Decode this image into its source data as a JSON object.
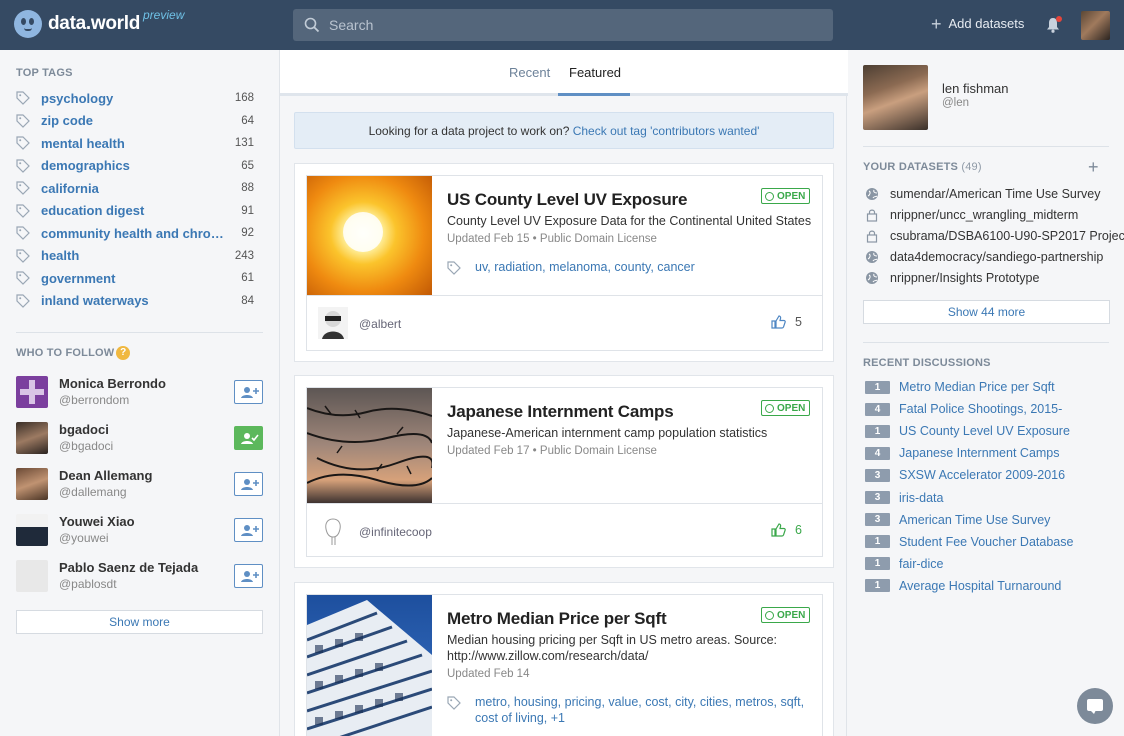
{
  "header": {
    "logo_text": "data.world",
    "logo_badge": "preview",
    "search_placeholder": "Search",
    "add_datasets_label": "Add datasets"
  },
  "top_tags": {
    "title": "TOP TAGS",
    "items": [
      {
        "name": "psychology",
        "count": "168"
      },
      {
        "name": "zip code",
        "count": "64"
      },
      {
        "name": "mental health",
        "count": "131"
      },
      {
        "name": "demographics",
        "count": "65"
      },
      {
        "name": "california",
        "count": "88"
      },
      {
        "name": "education digest",
        "count": "91"
      },
      {
        "name": "community health and chronic di...",
        "count": "92"
      },
      {
        "name": "health",
        "count": "243"
      },
      {
        "name": "government",
        "count": "61"
      },
      {
        "name": "inland waterways",
        "count": "84"
      }
    ]
  },
  "who_to_follow": {
    "title": "WHO TO FOLLOW",
    "help_glyph": "?",
    "users": [
      {
        "name": "Monica Berrondo",
        "handle": "@berrondom",
        "following": false
      },
      {
        "name": "bgadoci",
        "handle": "@bgadoci",
        "following": true
      },
      {
        "name": "Dean Allemang",
        "handle": "@dallemang",
        "following": false
      },
      {
        "name": "Youwei Xiao",
        "handle": "@youwei",
        "following": false
      },
      {
        "name": "Pablo Saenz de Tejada",
        "handle": "@pablosdt",
        "following": false
      }
    ],
    "show_more_label": "Show more"
  },
  "tabs": [
    {
      "label": "Recent",
      "active": false
    },
    {
      "label": "Featured",
      "active": true
    }
  ],
  "banner": {
    "text": "Looking for a data project to work on?",
    "link": "Check out tag 'contributors wanted'"
  },
  "cards": [
    {
      "title": "US County Level UV Exposure",
      "description": "County Level UV Exposure Data for the Continental United States",
      "meta": "Updated Feb 15 • Public Domain License",
      "badge": "OPEN",
      "tags": "uv, radiation, melanoma, county, cancer",
      "owner": "@albert",
      "likes": "5",
      "liked": false
    },
    {
      "title": "Japanese Internment Camps",
      "description": "Japanese-American internment camp population statistics",
      "meta": "Updated Feb 17 • Public Domain License",
      "badge": "OPEN",
      "tags": "",
      "owner": "@infinitecoop",
      "likes": "6",
      "liked": true
    },
    {
      "title": "Metro Median Price per Sqft",
      "description": "Median housing pricing per Sqft in US metro areas. Source: http://www.zillow.com/research/data/",
      "meta": "Updated Feb 14",
      "badge": "OPEN",
      "tags": "metro, housing, pricing, value, cost, city, cities, metros, sqft, cost of living, +1",
      "owner": "",
      "likes": "",
      "liked": false
    }
  ],
  "profile": {
    "name": "len fishman",
    "handle": "@len"
  },
  "your_datasets": {
    "title": "YOUR DATASETS",
    "count": "(49)",
    "items": [
      {
        "name": "sumendar/American Time Use Survey",
        "visibility": "public"
      },
      {
        "name": "nrippner/uncc_wrangling_midterm",
        "visibility": "private"
      },
      {
        "name": "csubrama/DSBA6100-U90-SP2017 Project",
        "visibility": "private"
      },
      {
        "name": "data4democracy/sandiego-partnership",
        "visibility": "public"
      },
      {
        "name": "nrippner/Insights Prototype",
        "visibility": "public"
      }
    ],
    "show_more_label": "Show 44 more"
  },
  "recent_discussions": {
    "title": "RECENT DISCUSSIONS",
    "items": [
      {
        "count": "1",
        "title": "Metro Median Price per Sqft"
      },
      {
        "count": "4",
        "title": "Fatal Police Shootings, 2015-"
      },
      {
        "count": "1",
        "title": "US County Level UV Exposure"
      },
      {
        "count": "4",
        "title": "Japanese Internment Camps"
      },
      {
        "count": "3",
        "title": "SXSW Accelerator 2009-2016"
      },
      {
        "count": "3",
        "title": "iris-data"
      },
      {
        "count": "3",
        "title": "American Time Use Survey"
      },
      {
        "count": "1",
        "title": "Student Fee Voucher Database"
      },
      {
        "count": "1",
        "title": "fair-dice"
      },
      {
        "count": "1",
        "title": "Average Hospital Turnaround"
      }
    ]
  },
  "colors": {
    "header_bg": "#354a63",
    "link": "#3b78b4",
    "open_green": "#3aa84a",
    "follow_green": "#5cb85c"
  }
}
